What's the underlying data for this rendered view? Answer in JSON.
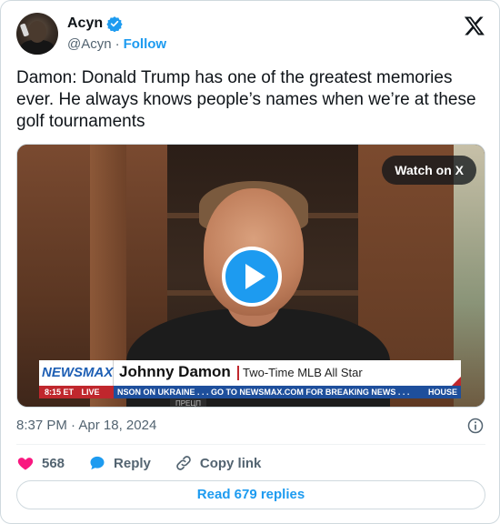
{
  "author": {
    "display_name": "Acyn",
    "handle": "@Acyn",
    "separator": "·",
    "follow_label": "Follow"
  },
  "tweet": {
    "text": "Damon: Donald Trump has one of the greatest memories ever. He always knows people’s names when we’re at these golf tournaments"
  },
  "media": {
    "watch_label": "Watch on X",
    "lower_third": {
      "network": "NEWSMAX",
      "name": "Johnny Damon",
      "title": "Two-Time MLB All Star"
    },
    "ticker": {
      "time": "8:15 ET",
      "live": "LIVE",
      "text": "NSON ON UKRAINE . . .      GO TO NEWSMAX.COM FOR BREAKING NEWS . . .",
      "right": "HOUSE",
      "sub": "ПРЕЦП"
    }
  },
  "meta": {
    "time": "8:37 PM",
    "separator": "·",
    "date": "Apr 18, 2024"
  },
  "actions": {
    "likes": "568",
    "reply_label": "Reply",
    "copy_label": "Copy link"
  },
  "read_replies_label": "Read 679 replies",
  "colors": {
    "accent": "#1d9bf0",
    "like": "#f91880",
    "text": "#0f1419",
    "muted": "#536471"
  }
}
